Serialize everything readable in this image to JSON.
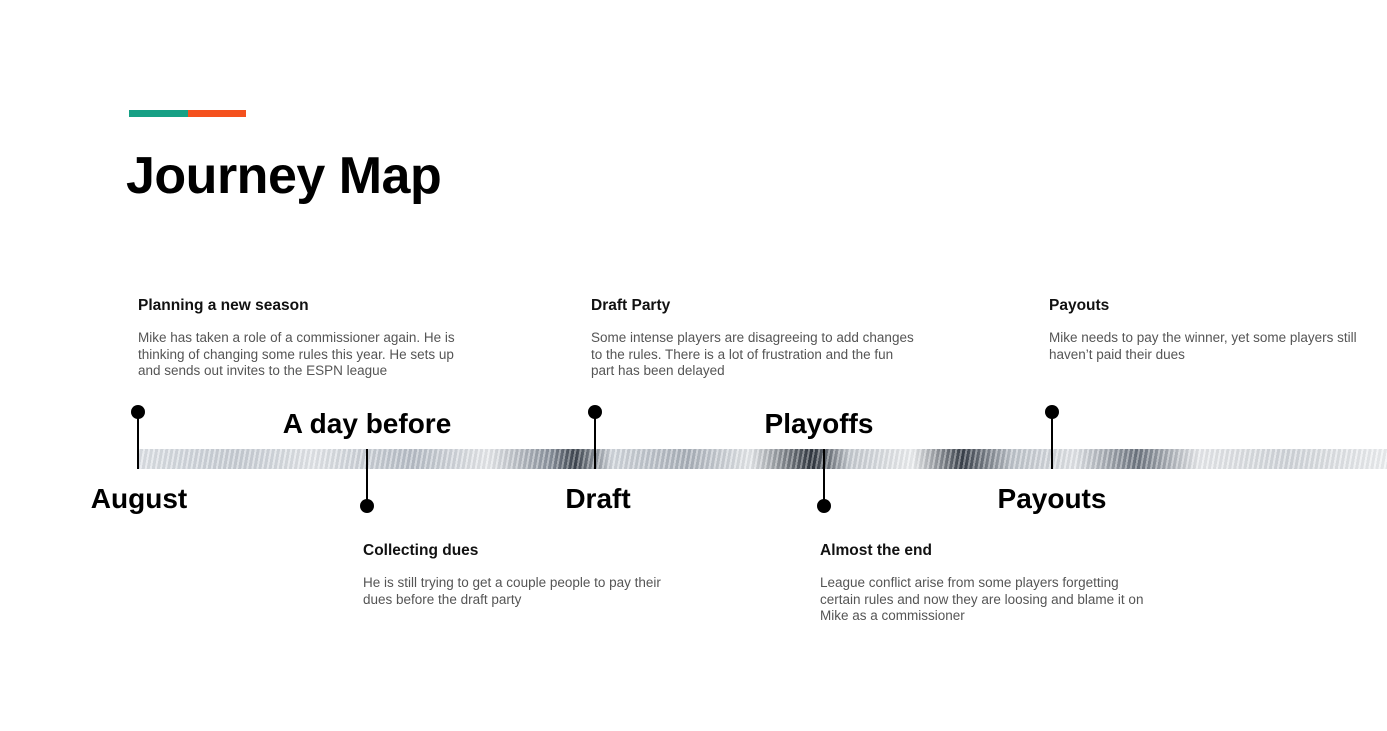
{
  "page": {
    "title": "Journey Map"
  },
  "accent_colors": {
    "teal": "#16a085",
    "orange": "#f4511e"
  },
  "timeline": {
    "milestones": [
      {
        "label": "August",
        "title": "Planning a new season",
        "text": "Mike has taken a role of a commissioner again. He is thinking of changing some rules this year. He sets up and sends out invites to the  ESPN league"
      },
      {
        "label": "A day before",
        "title": "Collecting dues",
        "text": "He is still  trying to get a couple people to pay their dues before the draft party"
      },
      {
        "label": "Draft",
        "title": "Draft Party",
        "text": "Some intense players are disagreeing to add changes to the rules.  There is a lot of frustration and the fun part has been delayed"
      },
      {
        "label": "Playoffs",
        "title": "Almost the end",
        "text": "League conflict arise from some players forgetting certain rules and now they are loosing and blame it on Mike as a commissioner"
      },
      {
        "label": "Payouts",
        "title": "Payouts",
        "text": "Mike needs to pay the winner, yet some players still haven’t paid their dues"
      }
    ]
  }
}
